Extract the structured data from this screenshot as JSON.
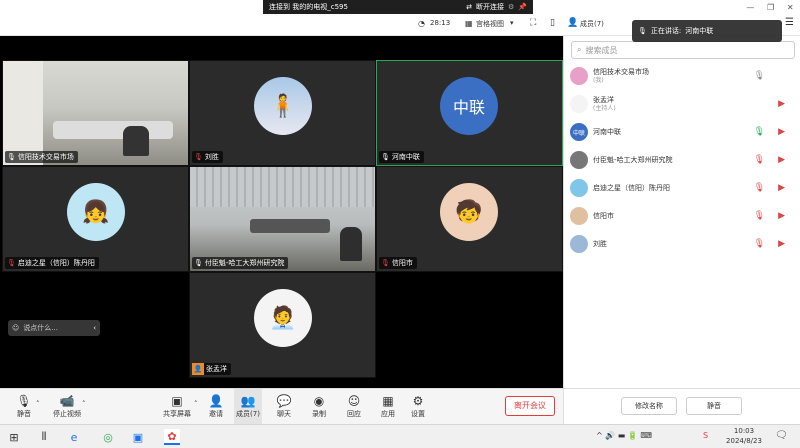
{
  "connection": {
    "title": "连接到 我的的电视_c595",
    "disconnect": "断开连接"
  },
  "header": {
    "timer": "28:13",
    "view_mode": "宫格视图",
    "members": "成员(7)"
  },
  "speaking": {
    "label": "正在讲话:",
    "name": "河南中联"
  },
  "tiles": [
    {
      "name": "信阳技术交易市场"
    },
    {
      "name": "刘胜"
    },
    {
      "name": "河南中联",
      "avatar_text": "中联"
    },
    {
      "name": "启迪之星（信阳）陈丹阳"
    },
    {
      "name": "付臣魁-哈工大郑州研究院"
    },
    {
      "name": "信阳市"
    },
    {
      "name": "张孟洋"
    }
  ],
  "chat_input": {
    "placeholder": "说点什么..."
  },
  "toolbar": [
    {
      "label": "静音",
      "icon": "mic-icon"
    },
    {
      "label": "停止视频",
      "icon": "camera-icon"
    },
    {
      "label": "共享屏幕",
      "icon": "share-screen-icon"
    },
    {
      "label": "邀请",
      "icon": "invite-icon"
    },
    {
      "label": "成员(7)",
      "icon": "members-icon"
    },
    {
      "label": "聊天",
      "icon": "chat-icon"
    },
    {
      "label": "录制",
      "icon": "record-icon"
    },
    {
      "label": "回应",
      "icon": "reaction-icon"
    },
    {
      "label": "应用",
      "icon": "apps-icon"
    },
    {
      "label": "设置",
      "icon": "settings-icon"
    }
  ],
  "leave_button": "离开会议",
  "panel": {
    "search_placeholder": "搜索成员",
    "members": [
      {
        "name": "信阳技术交易市场",
        "sub": "(我)",
        "color": "#e8a0c8"
      },
      {
        "name": "张孟洋",
        "sub": "(主持人)",
        "color": "#f4f4f4"
      },
      {
        "name": "河南中联",
        "sub": "",
        "color": "#3a6fc4",
        "avatar_text": "中联"
      },
      {
        "name": "付臣魁-哈工大郑州研究院",
        "sub": "",
        "color": "#777"
      },
      {
        "name": "启迪之星（信阳）陈丹阳",
        "sub": "",
        "color": "#7fc6e8"
      },
      {
        "name": "信阳市",
        "sub": "",
        "color": "#e0c0a0"
      },
      {
        "name": "刘胜",
        "sub": "",
        "color": "#9bb8d8"
      }
    ],
    "rename": "修改名称",
    "mute": "静音"
  },
  "taskbar": {
    "time": "10:03",
    "date": "2024/8/23"
  },
  "colors": {
    "active_border": "#2aa952",
    "leave_red": "#e03e3e",
    "muted_red": "#e04545",
    "mic_green": "#2aa952"
  }
}
